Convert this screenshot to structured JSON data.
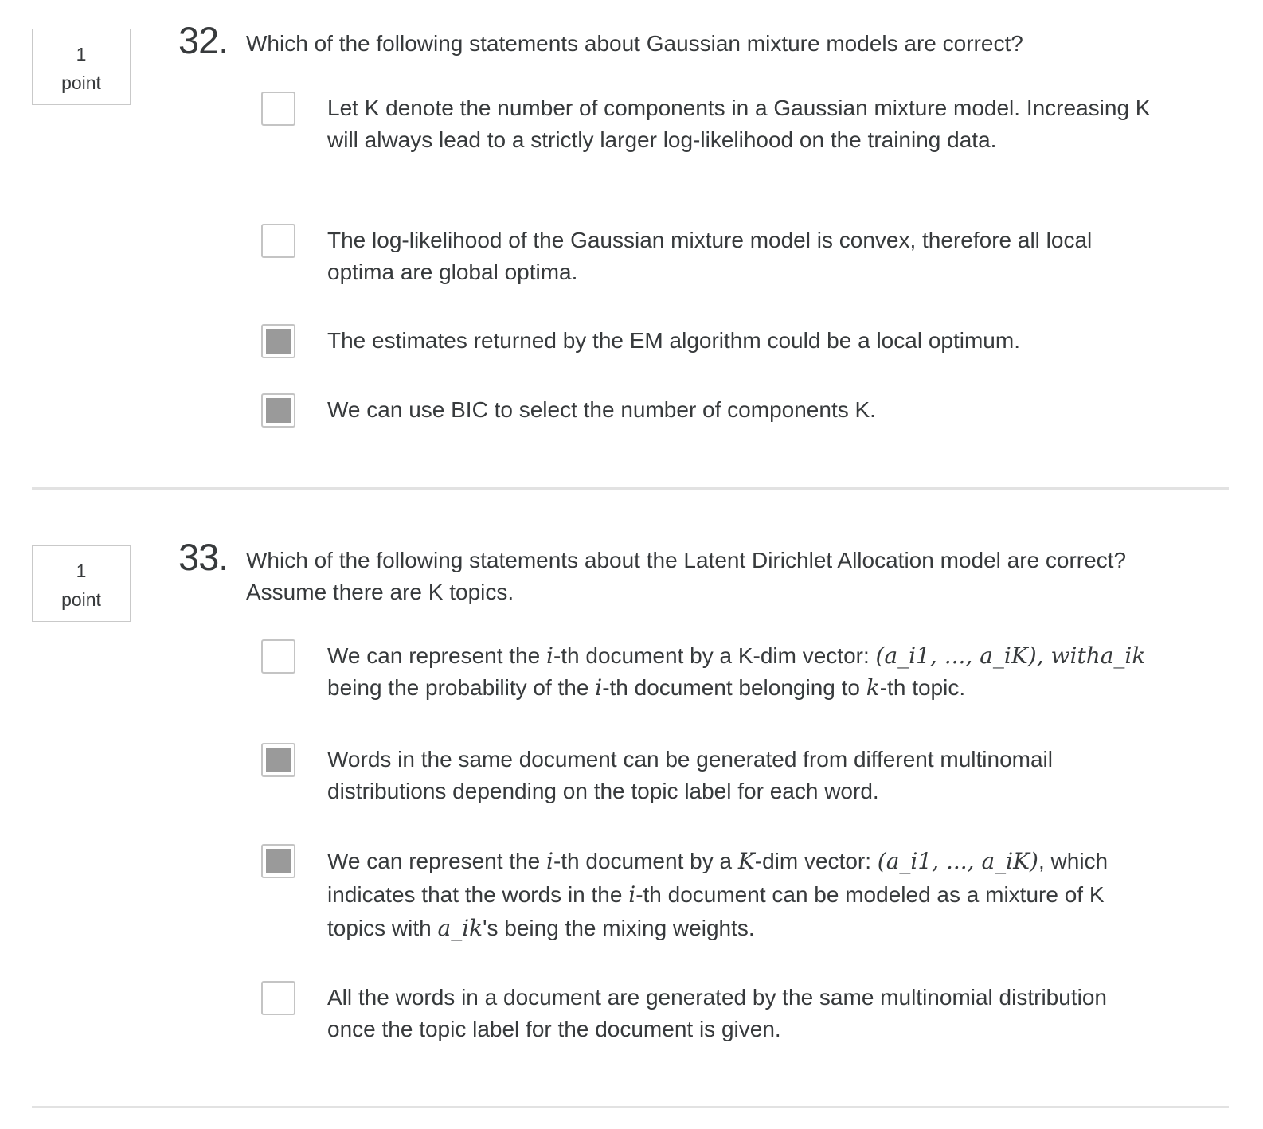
{
  "questions": [
    {
      "points_value": "1",
      "points_unit": "point",
      "number": "32.",
      "text": "Which of the following statements about Gaussian mixture models are correct?",
      "options": [
        {
          "text": "Let K denote the number of components in a Gaussian mixture model. Increasing K will always lead to a strictly larger log-likelihood on the training data.",
          "checked": false
        },
        {
          "text": "The log-likelihood of the Gaussian mixture model is convex, therefore all local optima are global optima.",
          "checked": false
        },
        {
          "text": "The estimates returned by the EM algorithm could be a local optimum.",
          "checked": true
        },
        {
          "text": "We can use BIC to select the number of components K.",
          "checked": true
        }
      ]
    },
    {
      "points_value": "1",
      "points_unit": "point",
      "number": "33.",
      "text": "Which of the following statements about the Latent Dirichlet Allocation model are correct? Assume there are K topics.",
      "options": [
        {
          "checked": false,
          "part1": "We can represent the ",
          "math1": "i",
          "part2": "-th document by a K-dim vector: ",
          "math2": "(a_i1, ..., a_iK), witha_ik",
          "part3": " being the probability of the ",
          "math3": "i",
          "part4": "-th document belonging to ",
          "math4": "k",
          "part5": "-th topic."
        },
        {
          "text": "Words in the same document can be generated from different multinomail distributions depending on the topic label for each word.",
          "checked": true
        },
        {
          "checked": true,
          "part1": "We can represent the ",
          "math1": "i",
          "part2": "-th document by a ",
          "math2": "K",
          "part3": "-dim vector: ",
          "math3": "(a_i1, ..., a_iK)",
          "part4": ", which indicates that the words in the ",
          "math4": "i",
          "part5": "-th document can be modeled as a mixture of K topics with ",
          "math5": "a_ik",
          "part6": "'s being the mixing weights."
        },
        {
          "text": "All the words in a document are generated by the same multinomial distribution once the topic label for the document is given.",
          "checked": false
        }
      ]
    }
  ]
}
